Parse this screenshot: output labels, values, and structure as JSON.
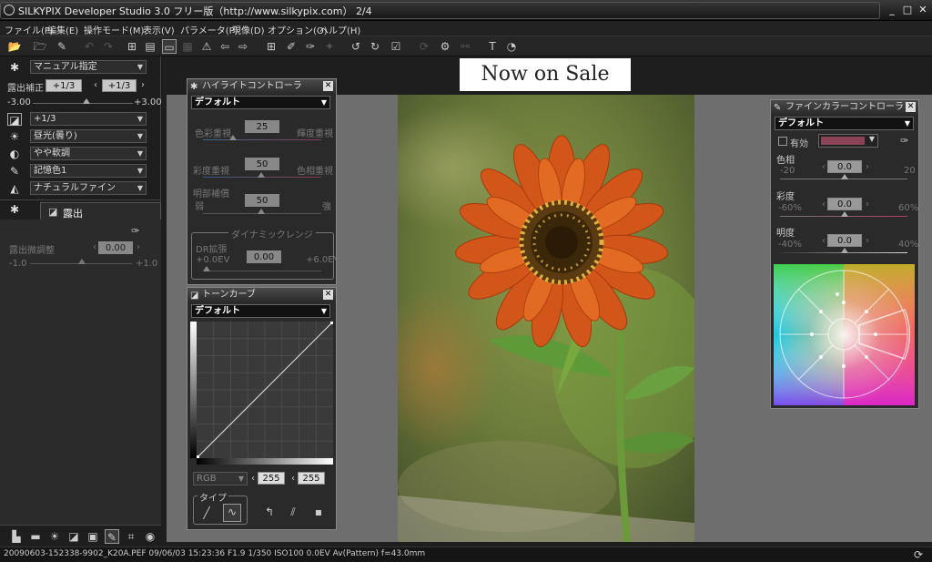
{
  "window": {
    "title": "SILKYPIX Developer Studio 3.0 フリー版（http://www.silkypix.com） 2/4",
    "min": "_",
    "max": "□",
    "close": "✕"
  },
  "menu": [
    "ファイル(F)",
    "編集(E)",
    "操作モード(M)",
    "表示(V)",
    "パラメータ(P)",
    "現像(D)",
    "オプション(O)",
    "ヘルプ(H)"
  ],
  "left": {
    "taste": "マニュアル指定",
    "exposure_label": "露出補正",
    "exposure_value1": "+1/3",
    "exposure_value2": "+1/3",
    "exposure_min": "-3.00",
    "exposure_max": "+3.00",
    "ev_dd": "+1/3",
    "wb_dd": "昼光(曇り)",
    "tone_dd": "やや軟調",
    "color_dd": "記憶色1",
    "sharp_dd": "ナチュラルファイン",
    "tab_label": "露出",
    "fine_label": "露出微調整",
    "fine_value": "0.00",
    "fine_min": "-1.0",
    "fine_max": "+1.0"
  },
  "sale": "Now on Sale",
  "highlight": {
    "title": "ハイライトコントローラ",
    "preset": "デフォルト",
    "s1_left": "色彩重視",
    "s1_right": "輝度重視",
    "s1_value": "25",
    "s2_left": "彩度重視",
    "s2_right": "色相重視",
    "s2_value": "50",
    "s3_top": "明部補償",
    "s3_left": "弱",
    "s3_right": "強",
    "s3_value": "50",
    "dr_title": "ダイナミックレンジ",
    "dr_label": "DR拡張",
    "dr_value": "0.00",
    "dr_min": "+0.0EV",
    "dr_max": "+6.0EV"
  },
  "tone": {
    "title": "トーンカーブ",
    "preset": "デフォルト",
    "channel": "RGB",
    "v1": "255",
    "v2": "255",
    "type_label": "タイプ"
  },
  "fine": {
    "title": "ファインカラーコントローラ",
    "preset": "デフォルト",
    "enable": "有効",
    "swatch_color": "#8a4455",
    "hue_label": "色相",
    "hue_min": "-20",
    "hue_max": "20",
    "hue_value": "0.0",
    "sat_label": "彩度",
    "sat_min": "-60%",
    "sat_max": "60%",
    "sat_value": "0.0",
    "bri_label": "明度",
    "bri_min": "-40%",
    "bri_max": "40%",
    "bri_value": "0.0"
  },
  "status": "20090603-152338-9902_K20A.PEF 09/06/03 15:23:36 F1.9 1/350 ISO100 0.0EV Av(Pattern) f=43.0mm"
}
